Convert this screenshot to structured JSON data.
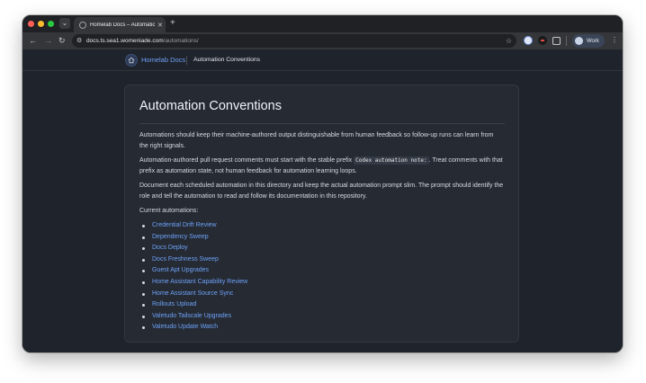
{
  "browser": {
    "tab_title": "Homelab Docs – Automation Conventions",
    "tab_close": "✕",
    "new_tab": "+",
    "tab_search": "⌄",
    "url_host": "docs.ts.sea1.womeniade.com",
    "url_path": "/automations/",
    "profile_label": "Work",
    "nav_back": "←",
    "nav_forward": "→",
    "nav_reload": "↻",
    "star": "☆",
    "menu": "⋮",
    "tune": "⚙"
  },
  "site": {
    "brand": "Homelab Docs",
    "breadcrumb": "Automation Conventions",
    "accent_color": "#6ea2f7"
  },
  "doc": {
    "title": "Automation Conventions",
    "p1": "Automations should keep their machine-authored output distinguishable from human feedback so follow-up runs can learn from the right signals.",
    "p2_before": "Automation-authored pull request comments must start with the stable prefix ",
    "p2_code": "Codex automation note:",
    "p2_after": ". Treat comments with that prefix as automation state, not human feedback for automation learning loops.",
    "p3": "Document each scheduled automation in this directory and keep the actual automation prompt slim. The prompt should identify the role and tell the automation to read and follow its documentation in this repository.",
    "list_heading": "Current automations:",
    "automations": [
      "Credential Drift Review",
      "Dependency Sweep",
      "Docs Deploy",
      "Docs Freshness Sweep",
      "Guest Apt Upgrades",
      "Home Assistant Capability Review",
      "Home Assistant Source Sync",
      "Rollouts Upload",
      "Valetudo Tailscale Upgrades",
      "Valetudo Update Watch"
    ]
  }
}
